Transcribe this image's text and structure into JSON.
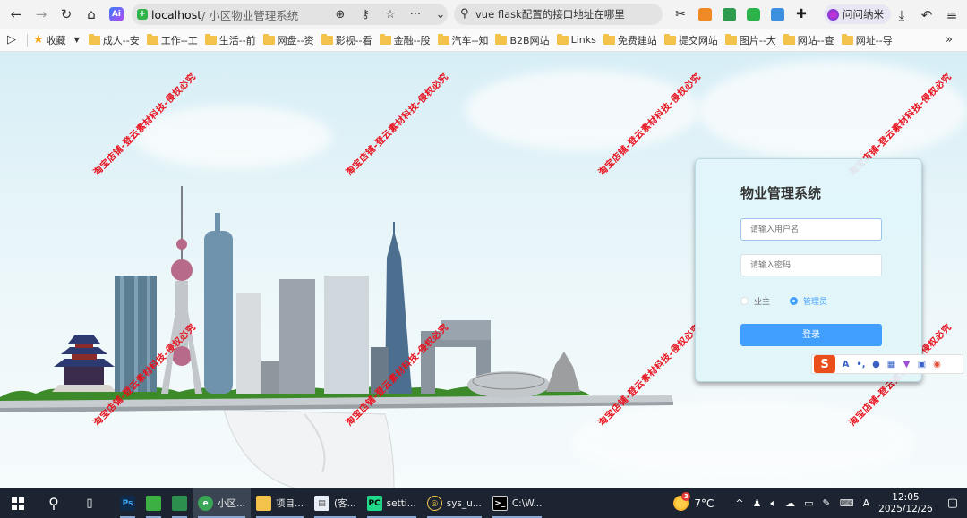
{
  "browser": {
    "address": {
      "host": "localhost",
      "path": " / 小区物业管理系统"
    },
    "search_text": "vue flask配置的接口地址在哪里",
    "wenwen_label": "问问纳米"
  },
  "bookmarks": {
    "favorites_label": "收藏",
    "folders": [
      "成人--安",
      "工作--工",
      "生活--前",
      "网盘--资",
      "影视--看",
      "金融--股",
      "汽车--知",
      "B2B网站",
      "Links",
      "免费建站",
      "提交网站",
      "图片--大",
      "网站--查",
      "网址--导"
    ]
  },
  "watermark_text": "淘宝店铺-登云素材科技-侵权必究",
  "login": {
    "title": "物业管理系统",
    "username_placeholder": "请输入用户名",
    "password_placeholder": "请输入密码",
    "role_owner": "业主",
    "role_admin": "管理员",
    "selected_role": "管理员",
    "submit_label": "登录"
  },
  "ime": {
    "logo": "S"
  },
  "taskbar": {
    "apps": [
      {
        "label": "Ps",
        "text": ""
      },
      {
        "label": "",
        "text": ""
      },
      {
        "label": "",
        "text": ""
      },
      {
        "label": "",
        "text": "小区..."
      },
      {
        "label": "",
        "text": "项目..."
      },
      {
        "label": "",
        "text": "(客..."
      },
      {
        "label": "PC",
        "text": "setti..."
      },
      {
        "label": "",
        "text": "sys_u..."
      },
      {
        "label": "",
        "text": "C:\\W..."
      }
    ],
    "weather_badge": "3",
    "temperature": "7°C",
    "ime_indicator": "A",
    "time": "12:05",
    "date": "2025/12/26"
  },
  "colors": {
    "accent": "#409eff",
    "watermark": "#e8101c",
    "taskbar": "#1b2430"
  }
}
